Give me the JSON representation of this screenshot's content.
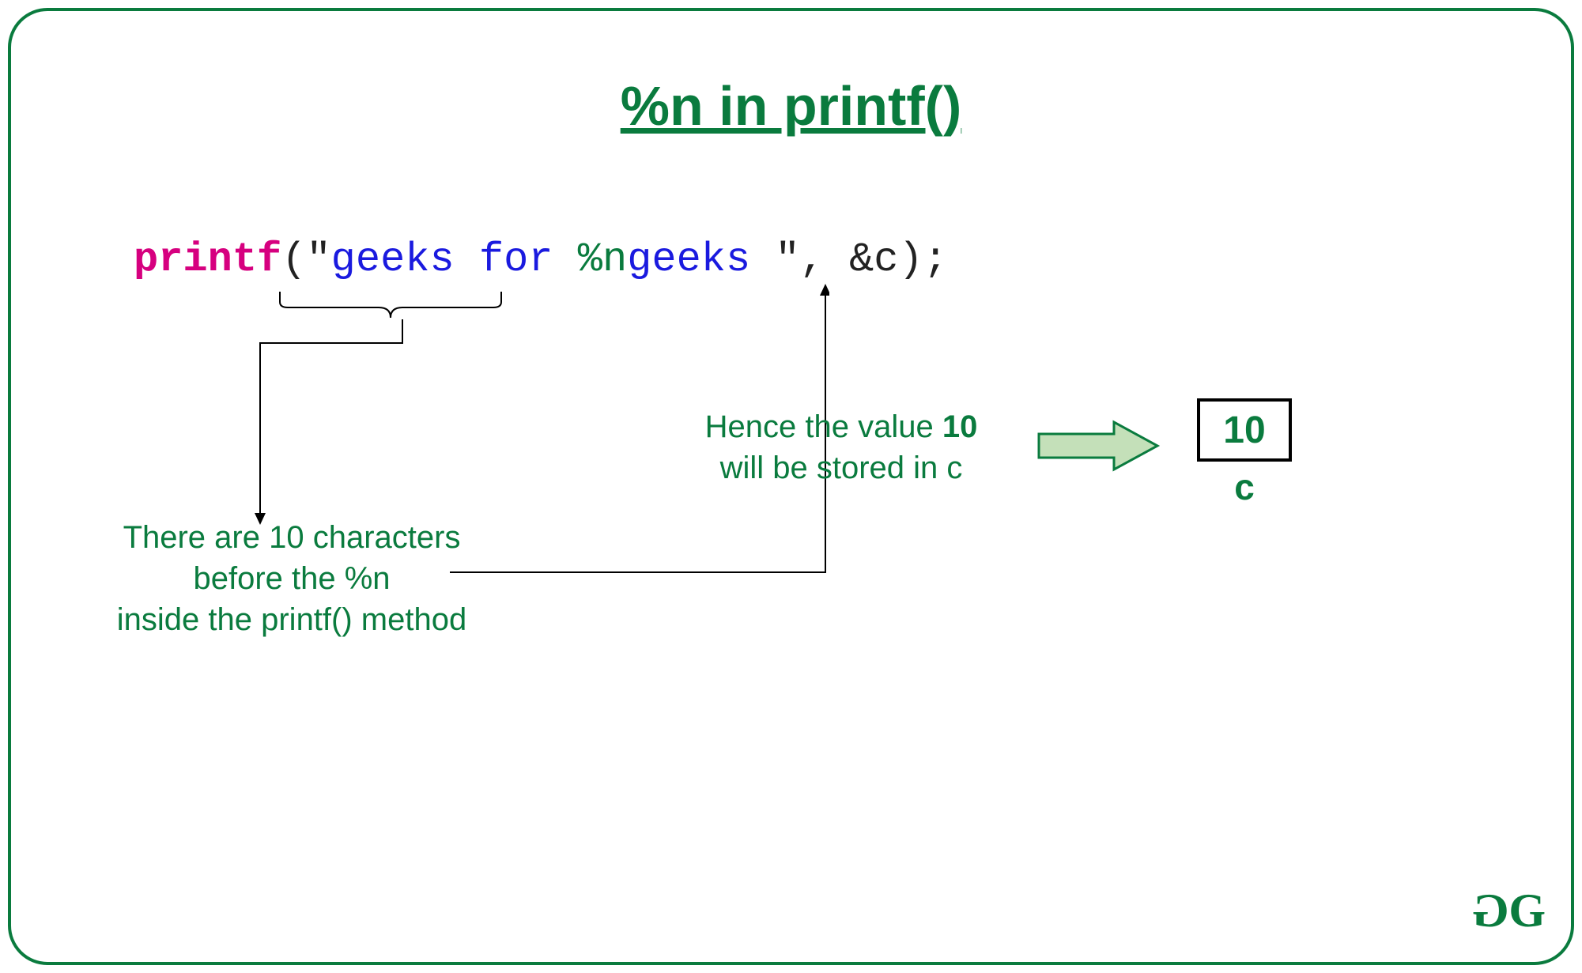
{
  "title": "%n in printf()",
  "code": {
    "keyword": "printf",
    "open_paren": "(",
    "quote1": "\"",
    "str_part1": "geeks",
    "str_gap1": " ",
    "str_part2": "for",
    "str_gap2": " ",
    "specifier": "%n",
    "str_part3": "geeks",
    "str_gap3": " ",
    "quote2": "\"",
    "rest": ", &c);"
  },
  "note_left": {
    "line1": "There are 10 characters",
    "line2": "before the %n",
    "line3": "inside the printf() method"
  },
  "note_right": {
    "prefix": "Hence the value ",
    "value": "10",
    "line2": "will be stored in c"
  },
  "box": {
    "value": "10",
    "label": "c"
  },
  "logo": {
    "g1": "G",
    "g2": "G"
  },
  "colors": {
    "accent_green": "#0a7b3e",
    "keyword_pink": "#d6007f",
    "string_blue": "#1a1adf",
    "arrow_fill": "#c4e0b9"
  }
}
